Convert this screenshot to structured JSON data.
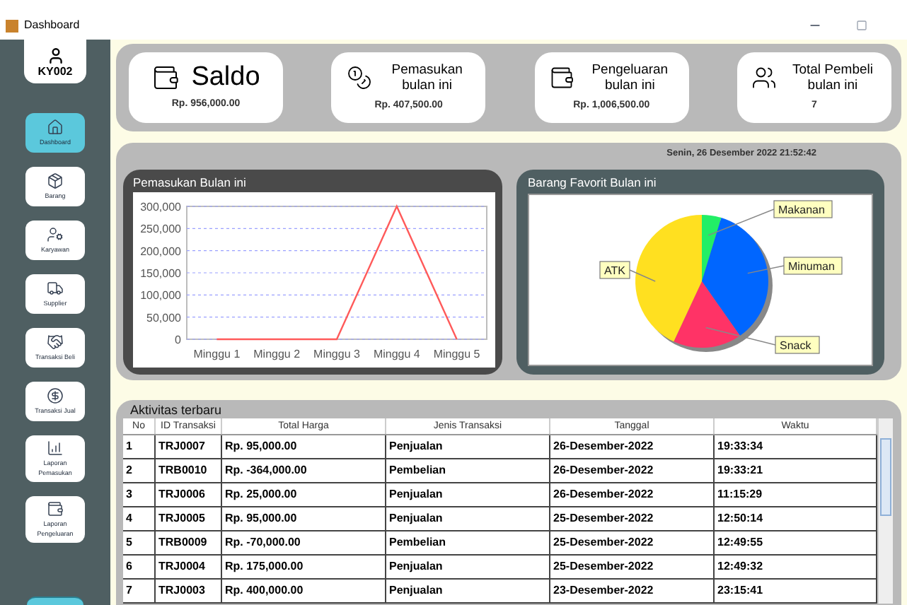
{
  "window": {
    "title": "Dashboard"
  },
  "user": {
    "id": "KY002"
  },
  "sidebar": {
    "items": [
      {
        "label": "Dashboard",
        "kind": "home",
        "selected": true
      },
      {
        "label": "Barang",
        "kind": "box",
        "selected": false
      },
      {
        "label": "Karyawan",
        "kind": "usercog",
        "selected": false
      },
      {
        "label": "Supplier",
        "kind": "supplier",
        "selected": false
      },
      {
        "label": "Transaksi Beli",
        "kind": "handshake",
        "selected": false
      },
      {
        "label": "Transaksi Jual",
        "kind": "exchange",
        "selected": false
      },
      {
        "label": "Laporan Pemasukan",
        "kind": "chart",
        "selected": false
      },
      {
        "label": "Laporan Pengeluaran",
        "kind": "wallet",
        "selected": false
      }
    ]
  },
  "summary_cards": [
    {
      "kind": "saldo",
      "title": "Saldo",
      "value": "Rp. 956,000.00"
    },
    {
      "kind": "income",
      "title": "Pemasukan bulan ini",
      "value": "Rp. 407,500.00"
    },
    {
      "kind": "expense",
      "title": "Pengeluaran bulan ini",
      "value": "Rp. 1,006,500.00"
    },
    {
      "kind": "buyers",
      "title": "Total Pembeli bulan ini",
      "value": "7"
    }
  ],
  "datetime": "Senin, 26 Desember 2022 21:52:42",
  "income_chart": {
    "title": "Pemasukan Bulan ini",
    "chart_data": {
      "type": "line",
      "categories": [
        "Minggu 1",
        "Minggu 2",
        "Minggu 3",
        "Minggu 4",
        "Minggu 5"
      ],
      "series": [
        {
          "color": "#ff5a5a",
          "values": [
            0,
            0,
            0,
            300000,
            0
          ]
        }
      ],
      "grid": true,
      "ylim": [
        0,
        300000
      ],
      "yticks": [
        {
          "value": 0,
          "label": "0"
        },
        {
          "value": 50000,
          "label": "50,000"
        },
        {
          "value": 100000,
          "label": "100,000"
        },
        {
          "value": 150000,
          "label": "150,000"
        },
        {
          "value": 200000,
          "label": "200,000"
        },
        {
          "value": 250000,
          "label": "250,000"
        },
        {
          "value": 300000,
          "label": "300,000"
        }
      ]
    }
  },
  "favorite_chart": {
    "title": "Barang Favorit Bulan ini",
    "labels": [
      "Makanan",
      "Minuman",
      "Snack",
      "ATK"
    ]
  },
  "activity": {
    "title": "Aktivitas terbaru",
    "columns": [
      "No",
      "ID Transaksi",
      "Total Harga",
      "Jenis Transaksi",
      "Tanggal",
      "Waktu"
    ],
    "rows": [
      [
        "1",
        "TRJ0007",
        "Rp. 95,000.00",
        "Penjualan",
        "26-Desember-2022",
        "19:33:34"
      ],
      [
        "2",
        "TRB0010",
        "Rp. -364,000.00",
        "Pembelian",
        "26-Desember-2022",
        "19:33:21"
      ],
      [
        "3",
        "TRJ0006",
        "Rp. 25,000.00",
        "Penjualan",
        "26-Desember-2022",
        "11:15:29"
      ],
      [
        "4",
        "TRJ0005",
        "Rp. 95,000.00",
        "Penjualan",
        "25-Desember-2022",
        "12:50:14"
      ],
      [
        "5",
        "TRB0009",
        "Rp. -70,000.00",
        "Pembelian",
        "25-Desember-2022",
        "12:49:55"
      ],
      [
        "6",
        "TRJ0004",
        "Rp. 175,000.00",
        "Penjualan",
        "25-Desember-2022",
        "12:49:32"
      ],
      [
        "7",
        "TRJ0003",
        "Rp. 400,000.00",
        "Penjualan",
        "23-Desember-2022",
        "23:15:41"
      ]
    ]
  }
}
